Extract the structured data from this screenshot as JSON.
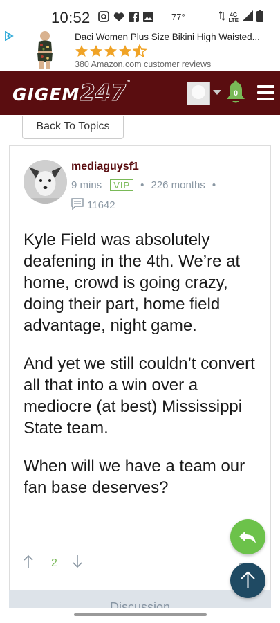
{
  "status_bar": {
    "time": "10:52",
    "temperature": "77°",
    "network": "4G LTE",
    "icons": [
      "messenger-icon",
      "heart-icon",
      "facebook-icon",
      "image-icon",
      "data-arrows-icon",
      "signal-icon",
      "battery-icon"
    ]
  },
  "ad": {
    "title": "Daci Women Plus Size Bikini High Waisted...",
    "rating": 4.5,
    "reviews": "380 Amazon.com customer reviews"
  },
  "header": {
    "logo_text": "GIGEM",
    "logo_number": "247",
    "logo_tm": "™",
    "notification_count": "0",
    "colors": {
      "brand": "#5a0d10",
      "bell": "#79b957"
    }
  },
  "back_button": {
    "label": "Back To Topics"
  },
  "post": {
    "username": "mediaguysf1",
    "time_ago": "9 mins",
    "badge": "VIP",
    "separator": "•",
    "membership": "226 months",
    "post_count": "11642",
    "paragraphs": [
      "Kyle Field was absolutely deafening in the 4th. We’re at home, crowd is going crazy, doing their part, home field advantage, night game.",
      "And yet we still couldn’t convert all that into a win over a mediocre (at best) Mississippi State team.",
      "When will we have a team our fan base deserves?"
    ],
    "votes": "2",
    "more_label": "ooo"
  },
  "discussion": {
    "label": "Discussion"
  },
  "colors": {
    "username": "#5a0d10",
    "meta": "#8a97a3",
    "vip": "#79b957",
    "fab_reply": "#6cc24a",
    "fab_top": "#1f4a63"
  }
}
